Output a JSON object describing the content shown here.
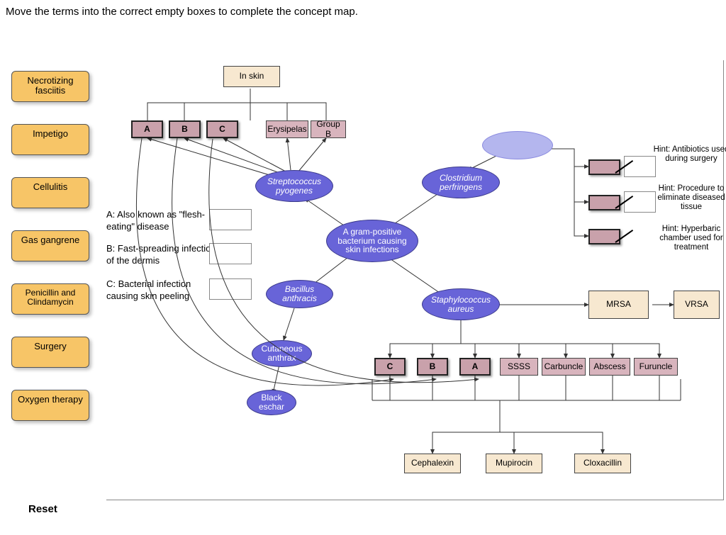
{
  "prompt": "Move the terms into the correct empty boxes to complete the concept map.",
  "reset_label": "Reset",
  "terms": [
    {
      "label": "Necrotizing fasciitis"
    },
    {
      "label": "Impetigo"
    },
    {
      "label": "Cellulitis"
    },
    {
      "label": "Gas gangrene"
    },
    {
      "label": "Penicillin and Clindamycin"
    },
    {
      "label": "Surgery"
    },
    {
      "label": "Oxygen therapy"
    }
  ],
  "top_box": "In skin",
  "row1": {
    "A": "A",
    "B": "B",
    "C": "C",
    "erysipelas": "Erysipelas",
    "groupB": "Group B"
  },
  "nodes": {
    "strep": "Streptococcus pyogenes",
    "clost": "Clostridium perfringens",
    "center": "A gram-positive bacterium causing skin infections",
    "bacillus": "Bacillus anthracis",
    "anthrax": "Cutaneous anthrax",
    "eschar": "Black eschar",
    "staph": "Staphylococcus aureus"
  },
  "mrsa": "MRSA",
  "vrsa": "VRSA",
  "staph_row": {
    "C": "C",
    "B": "B",
    "A": "A",
    "ssss": "SSSS",
    "carbuncle": "Carbuncle",
    "abscess": "Abscess",
    "furuncle": "Furuncle"
  },
  "treatments": {
    "cephalexin": "Cephalexin",
    "mupirocin": "Mupirocin",
    "cloxacillin": "Cloxacillin"
  },
  "captions": {
    "A": "A:  Also known as \"flesh-eating\" disease",
    "B": "B:  Fast-spreading infection of the dermis",
    "C": "C:  Bacterial infection causing skin peeling"
  },
  "hints": {
    "h1": "Hint: Antibiotics used during surgery",
    "h2": "Hint: Procedure to eliminate diseased tissue",
    "h3": "Hint: Hyperbaric chamber used for treatment"
  }
}
